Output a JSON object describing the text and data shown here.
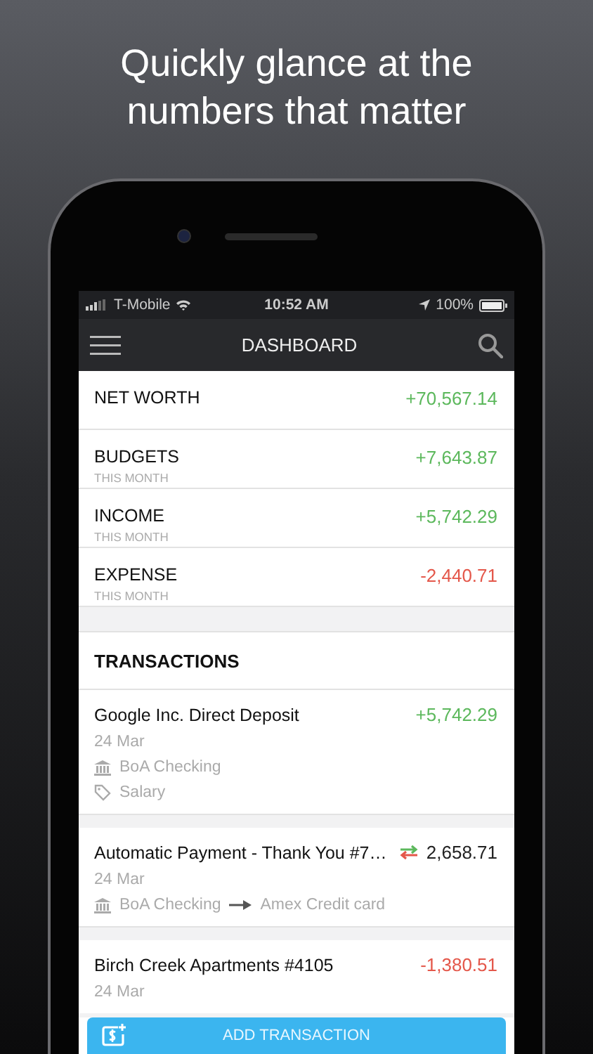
{
  "headline": "Quickly glance at the numbers that matter",
  "status_bar": {
    "carrier": "T-Mobile",
    "time": "10:52 AM",
    "battery": "100%"
  },
  "nav": {
    "title": "DASHBOARD"
  },
  "summary": [
    {
      "label": "NET WORTH",
      "amount": "+70,567.14",
      "color": "#5cb85c"
    },
    {
      "label": "BUDGETS",
      "sublabel": "THIS MONTH",
      "amount": "+7,643.87",
      "color": "#5cb85c"
    },
    {
      "label": "INCOME",
      "sublabel": "THIS MONTH",
      "amount": "+5,742.29",
      "color": "#5cb85c"
    },
    {
      "label": "EXPENSE",
      "sublabel": "THIS MONTH",
      "amount": "-2,440.71",
      "color": "#e4574a"
    }
  ],
  "transactions": {
    "title": "TRANSACTIONS",
    "items": [
      {
        "kind": "income",
        "name": "Google Inc. Direct Deposit",
        "amount": "+5,742.29",
        "color": "#5cb85c",
        "date": "24 Mar",
        "account": "BoA Checking",
        "tag": "Salary"
      },
      {
        "kind": "transfer",
        "name": "Automatic Payment - Thank You #7…",
        "amount": "2,658.71",
        "color": "#222222",
        "date": "24 Mar",
        "account": "BoA Checking",
        "to_account": "Amex Credit card"
      },
      {
        "kind": "expense",
        "name": "Birch Creek Apartments #4105",
        "amount": "-1,380.51",
        "color": "#e4574a",
        "date": "24 Mar"
      }
    ]
  },
  "add_button": "ADD TRANSACTION"
}
